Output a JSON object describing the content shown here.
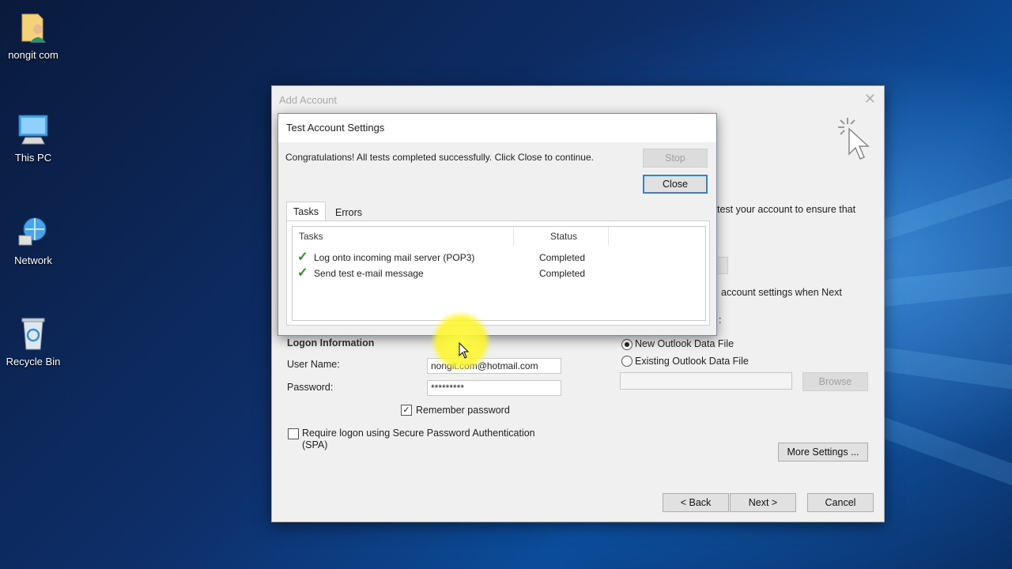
{
  "desktop": {
    "icons": [
      {
        "label": "nongit com",
        "icon": "user-folder-icon"
      },
      {
        "label": "This PC",
        "icon": "computer-icon"
      },
      {
        "label": "Network",
        "icon": "network-icon"
      },
      {
        "label": "Recycle Bin",
        "icon": "recycle-bin-icon"
      }
    ]
  },
  "add_account": {
    "title": "Add Account",
    "partial_text_1": "test your account to ensure that",
    "partial_text_2": "account settings when Next",
    "partial_text_3": ":",
    "logon": {
      "heading": "Logon Information",
      "user_name_label": "User Name:",
      "user_name_value": "nongit.com@hotmail.com",
      "password_label": "Password:",
      "password_value": "*********",
      "remember_label": "Remember password",
      "remember_checked": true,
      "spa_label": "Require logon using Secure Password Authentication (SPA)",
      "spa_checked": false
    },
    "deliver": {
      "option_new": "New Outlook Data File",
      "option_existing": "Existing Outlook Data File",
      "selected": "new",
      "path_value": "",
      "browse_label": "Browse"
    },
    "more_settings_label": "More Settings ...",
    "back_label": "< Back",
    "next_label": "Next >",
    "cancel_label": "Cancel"
  },
  "test_dialog": {
    "title": "Test Account Settings",
    "message": "Congratulations! All tests completed successfully. Click Close to continue.",
    "stop_label": "Stop",
    "close_label": "Close",
    "tabs": [
      {
        "label": "Tasks",
        "active": true
      },
      {
        "label": "Errors",
        "active": false
      }
    ],
    "columns": {
      "task": "Tasks",
      "status": "Status"
    },
    "rows": [
      {
        "task": "Log onto incoming mail server (POP3)",
        "status": "Completed"
      },
      {
        "task": "Send test e-mail message",
        "status": "Completed"
      }
    ]
  },
  "colors": {
    "accent": "#3c7fd0",
    "check": "#2e8b2e",
    "highlight": "#fff53c"
  }
}
